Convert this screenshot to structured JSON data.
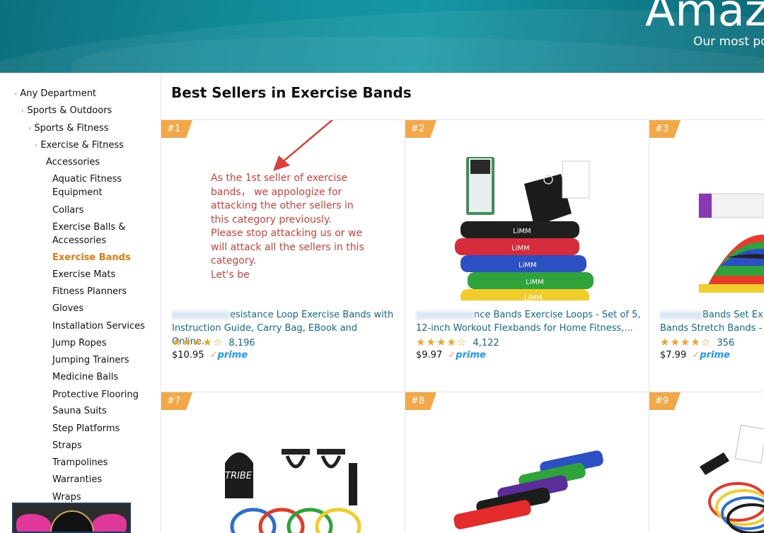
{
  "banner": {
    "title": "Amaz",
    "subtitle": "Our most pop"
  },
  "sidebar": {
    "items": [
      {
        "label": "Any Department"
      },
      {
        "label": "Sports & Outdoors"
      },
      {
        "label": "Sports & Fitness"
      },
      {
        "label": "Exercise & Fitness"
      },
      {
        "label": "Accessories"
      },
      {
        "label": "Aquatic Fitness"
      },
      {
        "label": "Equipment"
      },
      {
        "label": "Collars"
      },
      {
        "label": "Exercise Balls &"
      },
      {
        "label": "Accessories"
      },
      {
        "label": "Exercise Bands"
      },
      {
        "label": "Exercise Mats"
      },
      {
        "label": "Fitness Planners"
      },
      {
        "label": "Gloves"
      },
      {
        "label": "Installation Services"
      },
      {
        "label": "Jump Ropes"
      },
      {
        "label": "Jumping Trainers"
      },
      {
        "label": "Medicine Balls"
      },
      {
        "label": "Protective Flooring"
      },
      {
        "label": "Sauna Suits"
      },
      {
        "label": "Step Platforms"
      },
      {
        "label": "Straps"
      },
      {
        "label": "Trampolines"
      },
      {
        "label": "Warranties"
      },
      {
        "label": "Wraps"
      }
    ],
    "chevron": "‹"
  },
  "main": {
    "title": "Best Sellers in Exercise Bands",
    "note_lines": [
      "As the 1st seller of exercise",
      "bands， we appologize for",
      "attacking the other sellers in",
      "this category previously.",
      "Please stop attacking us or we",
      "will attack all the sellers in this",
      "category.",
      "Let's be"
    ],
    "products": [
      {
        "rank": "#1",
        "title_line1": "esistance Loop Exercise Bands with",
        "title_line2": "Instruction Guide, Carry Bag, EBook and Online...",
        "stars": "★★★★☆",
        "reviews": "8,196",
        "price": "$10.95",
        "prime": "prime"
      },
      {
        "rank": "#2",
        "title_line1": "nce Bands Exercise Loops - Set of 5,",
        "title_line2": "12-inch Workout Flexbands for Home Fitness,...",
        "stars": "★★★★☆",
        "reviews": "4,122",
        "price": "$9.97",
        "prime": "prime"
      },
      {
        "rank": "#3",
        "title_line1": "Bands Set Ex",
        "title_line2": "Bands Stretch Bands - L",
        "stars": "★★★★☆",
        "reviews": "356",
        "price": "$7.99",
        "prime": "prime"
      },
      {
        "rank": "#7"
      },
      {
        "rank": "#8"
      },
      {
        "rank": "#9"
      }
    ],
    "band_labels": [
      "LiMM",
      "LiMM",
      "LiMM",
      "LiMM",
      "LiMM"
    ],
    "bag_label": "TRIBE"
  }
}
